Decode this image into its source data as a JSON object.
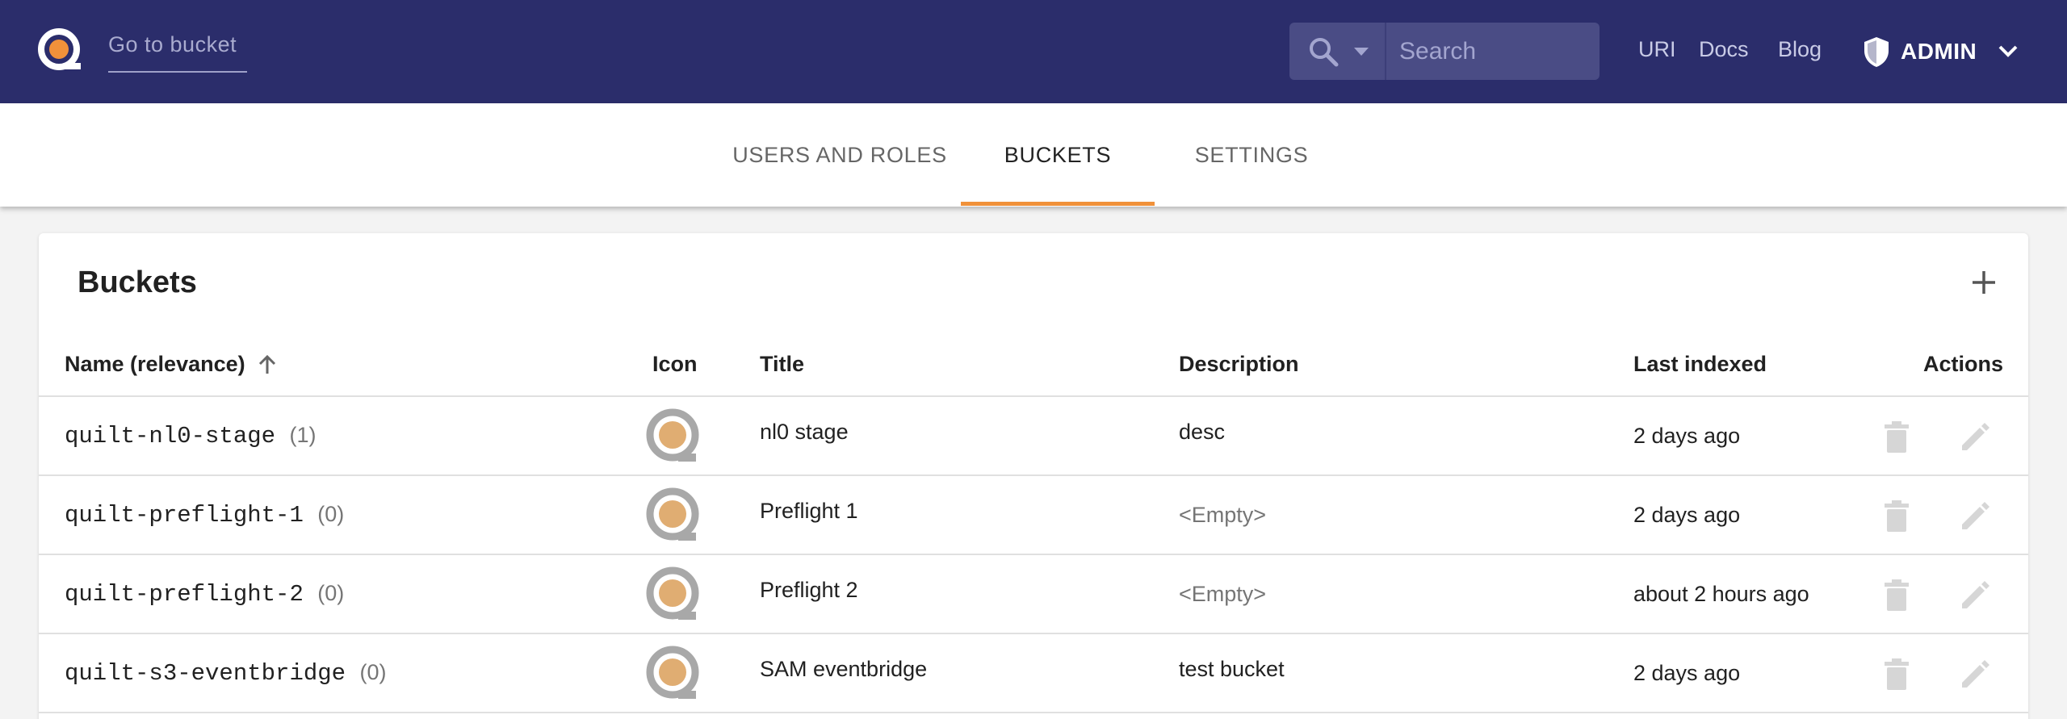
{
  "header": {
    "go_to_bucket": "Go to bucket",
    "search_placeholder": "Search",
    "links": [
      "URI",
      "Docs",
      "Blog"
    ],
    "user_label": "ADMIN"
  },
  "tabs": [
    {
      "label": "USERS AND ROLES",
      "active": false
    },
    {
      "label": "BUCKETS",
      "active": true
    },
    {
      "label": "SETTINGS",
      "active": false
    }
  ],
  "buckets": {
    "title": "Buckets",
    "columns": [
      "Name (relevance)",
      "Icon",
      "Title",
      "Description",
      "Last indexed",
      "Actions"
    ],
    "rows": [
      {
        "name": "quilt-nl0-stage",
        "count": "(1)",
        "title": "nl0 stage",
        "description": "desc",
        "last_indexed": "2 days ago"
      },
      {
        "name": "quilt-preflight-1",
        "count": "(0)",
        "title": "Preflight 1",
        "description": "<Empty>",
        "last_indexed": "2 days ago"
      },
      {
        "name": "quilt-preflight-2",
        "count": "(0)",
        "title": "Preflight 2",
        "description": "<Empty>",
        "last_indexed": "about 2 hours ago"
      },
      {
        "name": "quilt-s3-eventbridge",
        "count": "(0)",
        "title": "SAM eventbridge",
        "description": "test bucket",
        "last_indexed": "2 days ago"
      }
    ]
  },
  "colors": {
    "appbar": "#2b2d6b",
    "accent": "#f0913a",
    "icon_ring": "#a8a8a8",
    "icon_dot": "#e0ad72"
  }
}
